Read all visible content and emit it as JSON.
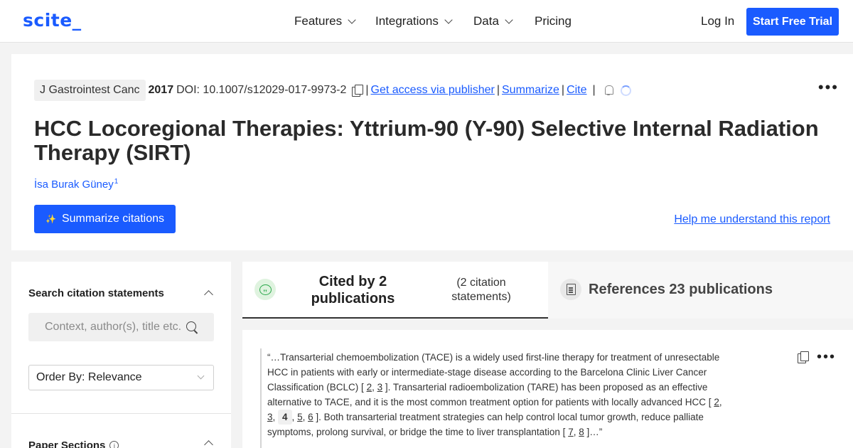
{
  "nav": {
    "logo": "scite_",
    "items": [
      "Features",
      "Integrations",
      "Data",
      "Pricing"
    ],
    "login": "Log In",
    "cta": "Start Free Trial"
  },
  "paper": {
    "journal": "J Gastrointest Canc",
    "year": "2017",
    "doi": "DOI: 10.1007/s12029-017-9973-2",
    "links": {
      "access": "Get access via publisher",
      "summarize": "Summarize",
      "cite": "Cite"
    },
    "title": "HCC Locoregional Therapies: Yttrium-90 (Y-90) Selective Internal Radiation Therapy (SIRT)",
    "author": "İsa Burak Güney",
    "author_sup": "1",
    "summarize_button": "Summarize citations",
    "help_link": "Help me understand this report"
  },
  "sidebar": {
    "search_title": "Search citation statements",
    "search_placeholder": "Context, author(s), title etc.",
    "order_by": "Order By: Relevance",
    "sections_title": "Paper Sections",
    "info_glyph": "i"
  },
  "tabs": {
    "cited_label": "Cited by 2 publications",
    "cited_sub": "(2 citation statements)",
    "refs_label": "References 23 publications",
    "quote_glyph": ",,"
  },
  "citation": {
    "part1": "“…Transarterial chemoembolization (TACE) is a widely used first-line therapy for treatment of unresectable HCC in patients with early or intermediate-stage disease according to the Barcelona Clinic Liver Cancer Classification (BCLC) [",
    "ref_a": "2",
    "ref_b": "3",
    "part2": "]. Transarterial radioembolization (TARE) has been proposed as an effective alternative to TACE, and it is the most common treatment option for patients with locally advanced HCC [",
    "ref_c": "2",
    "ref_d": "3",
    "ref_e": "4",
    "ref_f": "5",
    "ref_g": "6",
    "part3": "]. Both transarterial treatment strategies can help control local tumor growth, reduce palliate symptoms, prolong survival, or bridge the time to liver transplantation [",
    "ref_h": "7",
    "ref_i": "8",
    "part4": "]…”",
    "more_glyph": "•••"
  },
  "colors": {
    "brand": "#1a5bff",
    "quote_green": "#2aa84a"
  }
}
